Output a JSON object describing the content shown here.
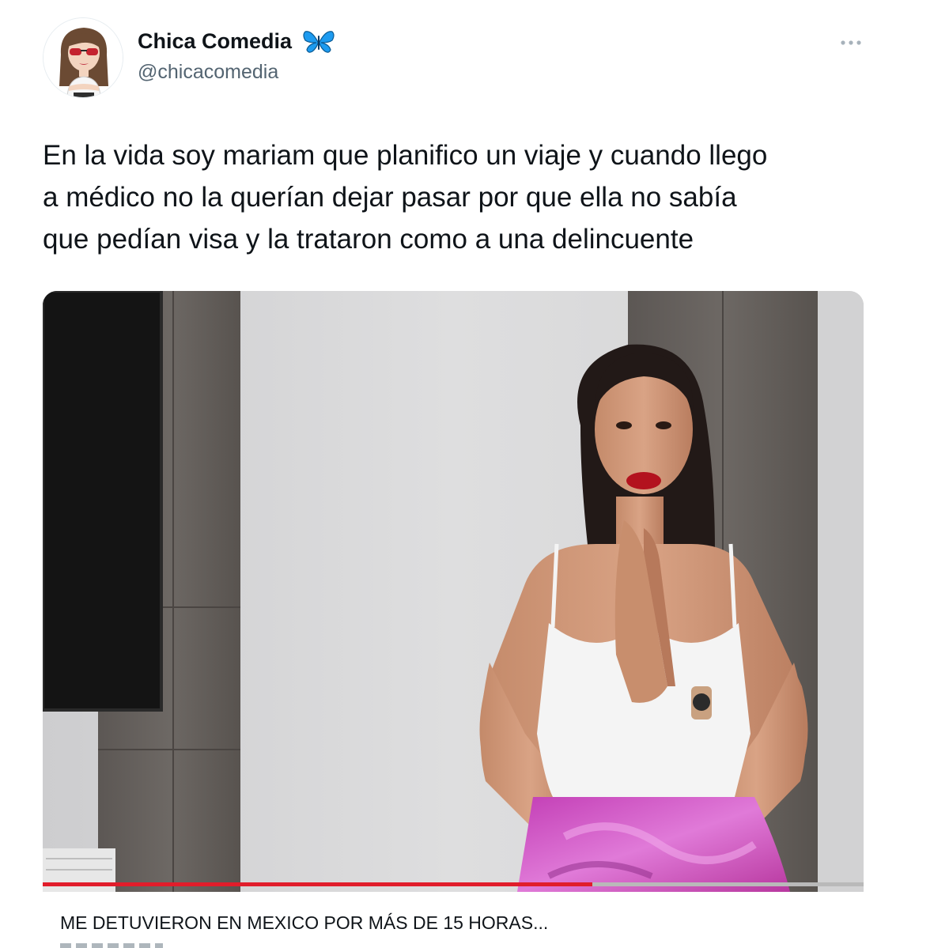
{
  "tweet": {
    "author": {
      "display_name": "Chica Comedia",
      "handle": "@chicacomedia",
      "badge_icon": "butterfly-icon",
      "badge_color": "#1d9bf0"
    },
    "menu_icon": "more-horizontal-icon",
    "text_lines": [
      "En la vida soy mariam que planifico un viaje y cuando llego",
      "a médico no la querían dejar pasar por que ella no sabía",
      "que pedían visa y la trataron como a una delincuente"
    ],
    "media": {
      "kind": "video-thumbnail",
      "progress_fraction": 0.67,
      "progress_color": "#e11d2b",
      "title": "ME DETUVIERON EN MEXICO POR MÁS DE 15 HORAS..."
    }
  },
  "colors": {
    "text_primary": "#0f1419",
    "text_secondary": "#536471"
  }
}
